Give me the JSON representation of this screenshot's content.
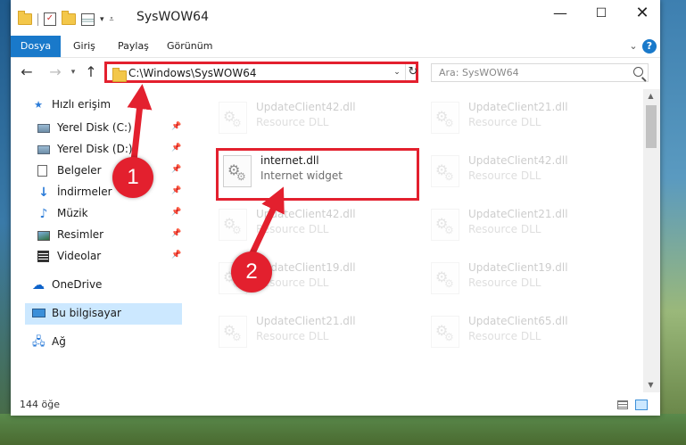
{
  "window": {
    "title": "SysWOW64",
    "minimize": "—",
    "maximize": "☐",
    "close": "✕"
  },
  "ribbon": {
    "tabs": [
      "Dosya",
      "Giriş",
      "Paylaş",
      "Görünüm"
    ],
    "collapse_glyph": "⌄",
    "help_glyph": "?"
  },
  "address": {
    "path": "C:\\Windows\\SysWOW64",
    "search_placeholder": "Ara: SysWOW64"
  },
  "nav": {
    "quick_access": "Hızlı erişim",
    "items": [
      {
        "label": "Yerel Disk (C:)",
        "icon": "drive-icon"
      },
      {
        "label": "Yerel Disk (D:)",
        "icon": "drive-icon"
      },
      {
        "label": "Belgeler",
        "icon": "documents-icon"
      },
      {
        "label": "İndirmeler",
        "icon": "downloads-icon"
      },
      {
        "label": "Müzik",
        "icon": "music-icon"
      },
      {
        "label": "Resimler",
        "icon": "pictures-icon"
      },
      {
        "label": "Videolar",
        "icon": "videos-icon"
      }
    ],
    "onedrive": "OneDrive",
    "this_pc": "Bu bilgisayar",
    "network": "Ağ"
  },
  "files": [
    {
      "name": "UpdateClient42.dll",
      "desc": "Resource DLL"
    },
    {
      "name": "UpdateClient21.dll",
      "desc": "Resource DLL"
    },
    {
      "name": "internet.dll",
      "desc": "Internet widget"
    },
    {
      "name": "UpdateClient42.dll",
      "desc": "Resource DLL"
    },
    {
      "name": "UpdateClient42.dll",
      "desc": "Resource DLL"
    },
    {
      "name": "UpdateClient21.dll",
      "desc": "Resource DLL"
    },
    {
      "name": "UpdateClient19.dll",
      "desc": "Resource DLL"
    },
    {
      "name": "UpdateClient19.dll",
      "desc": "Resource DLL"
    },
    {
      "name": "UpdateClient21.dll",
      "desc": "Resource DLL"
    },
    {
      "name": "UpdateClient65.dll",
      "desc": "Resource DLL"
    }
  ],
  "status": {
    "count": "144 öğe"
  },
  "annotations": {
    "step1": "1",
    "step2": "2",
    "color": "#e3202e"
  },
  "colors": {
    "accent": "#1979ca",
    "selection": "#cce8ff",
    "highlight": "#e3202e"
  }
}
